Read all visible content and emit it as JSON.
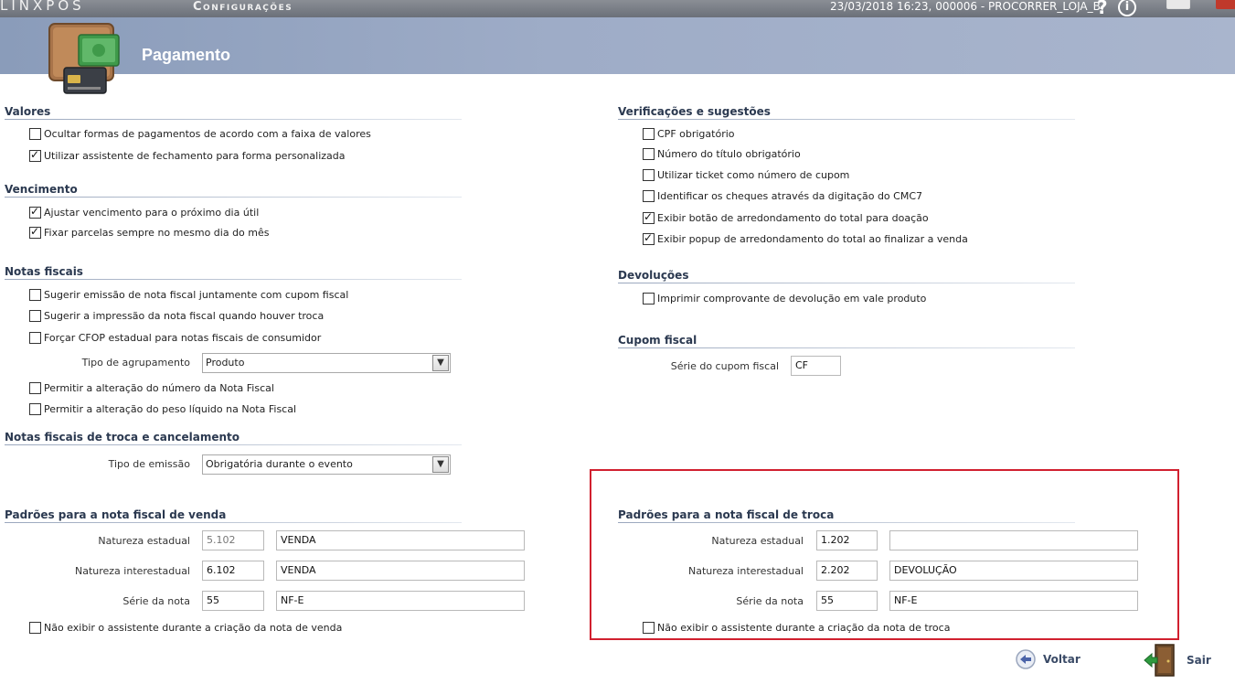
{
  "topbar": {
    "brand": "LINXPOS",
    "app_title": "Configurações",
    "status": "23/03/2018 16:23, 000006 - PROCORRER_LOJA_B.",
    "help_label": "?",
    "info_label": "i"
  },
  "header": {
    "title": "Pagamento"
  },
  "sections": {
    "valores": {
      "title": "Valores",
      "items": [
        {
          "label": "Ocultar formas de pagamentos de acordo com a faixa de valores",
          "checked": false
        },
        {
          "label": "Utilizar assistente de fechamento para forma personalizada",
          "checked": true
        }
      ]
    },
    "vencimento": {
      "title": "Vencimento",
      "items": [
        {
          "label": "Ajustar vencimento para o próximo dia útil",
          "checked": true
        },
        {
          "label": "Fixar parcelas sempre no mesmo dia do mês",
          "checked": true
        }
      ]
    },
    "notas_fiscais": {
      "title": "Notas fiscais",
      "items": [
        {
          "label": "Sugerir emissão de nota fiscal juntamente com cupom fiscal",
          "checked": false
        },
        {
          "label": "Sugerir a impressão da nota fiscal quando houver troca",
          "checked": false
        },
        {
          "label": "Forçar CFOP estadual para notas fiscais de consumidor",
          "checked": false
        }
      ],
      "agrupamento_label": "Tipo de agrupamento",
      "agrupamento_value": "Produto",
      "items2": [
        {
          "label": "Permitir a alteração do número da Nota Fiscal",
          "checked": false
        },
        {
          "label": "Permitir a alteração do peso líquido na Nota Fiscal",
          "checked": false
        }
      ]
    },
    "troca_cancelamento": {
      "title": "Notas fiscais de troca e cancelamento",
      "emissao_label": "Tipo de emissão",
      "emissao_value": "Obrigatória durante o evento"
    },
    "nota_venda": {
      "title": "Padrões para a nota fiscal de venda",
      "rows": [
        {
          "label": "Natureza estadual",
          "code": "5.102",
          "desc": "VENDA"
        },
        {
          "label": "Natureza interestadual",
          "code": "6.102",
          "desc": "VENDA"
        },
        {
          "label": "Série da nota",
          "code": "55",
          "desc": "NF-E"
        }
      ],
      "checkbox": {
        "label": "Não exibir o assistente durante a criação da nota de venda",
        "checked": false
      }
    },
    "verificacoes": {
      "title": "Verificações e sugestões",
      "items": [
        {
          "label": "CPF obrigatório",
          "checked": false
        },
        {
          "label": "Número do título obrigatório",
          "checked": false
        },
        {
          "label": "Utilizar ticket como número de cupom",
          "checked": false
        },
        {
          "label": "Identificar os cheques através da digitação do CMC7",
          "checked": false
        },
        {
          "label": "Exibir botão de arredondamento do total para doação",
          "checked": true
        },
        {
          "label": "Exibir popup de arredondamento do total ao finalizar a venda",
          "checked": true
        }
      ]
    },
    "devolucoes": {
      "title": "Devoluções",
      "items": [
        {
          "label": "Imprimir comprovante de devolução em vale produto",
          "checked": false
        }
      ]
    },
    "cupom_fiscal": {
      "title": "Cupom fiscal",
      "serie_label": "Série do cupom fiscal",
      "serie_value": "CF"
    },
    "nota_troca": {
      "title": "Padrões para a nota fiscal de troca",
      "rows": [
        {
          "label": "Natureza estadual",
          "code": "1.202",
          "desc": ""
        },
        {
          "label": "Natureza interestadual",
          "code": "2.202",
          "desc": "DEVOLUÇÃO"
        },
        {
          "label": "Série da nota",
          "code": "55",
          "desc": "NF-E"
        }
      ],
      "checkbox": {
        "label": "Não exibir o assistente durante a criação da nota de troca",
        "checked": false
      }
    }
  },
  "footer": {
    "back_label": "Voltar",
    "exit_label": "Sair"
  },
  "colors": {
    "highlight_border": "#d1202f",
    "header_bg": "#9eacc7",
    "section_title": "#2b3950"
  }
}
